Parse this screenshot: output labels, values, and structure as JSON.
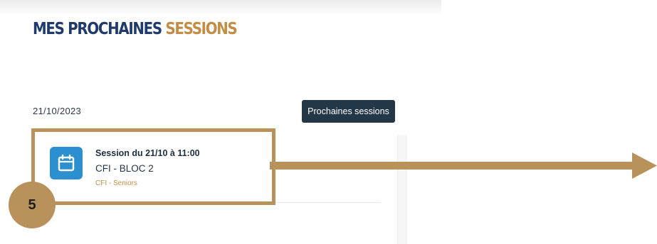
{
  "header": {
    "title_main": "MES PROCHAINES",
    "title_accent": "SESSIONS"
  },
  "sessions": {
    "date": "21/10/2023",
    "next_button": "Prochaines sessions",
    "items": [
      {
        "title": "Session du 21/10 à 11:00",
        "name": "CFI - BLOC 2",
        "category": "CFI - Seniors",
        "icon": "calendar-icon"
      }
    ]
  },
  "annotation": {
    "step_number": "5",
    "color": "#b9915a"
  },
  "colors": {
    "title_blue": "#1f3a6b",
    "accent_gold": "#c28e45",
    "button_dark": "#233747",
    "icon_blue": "#2b8fd0"
  }
}
